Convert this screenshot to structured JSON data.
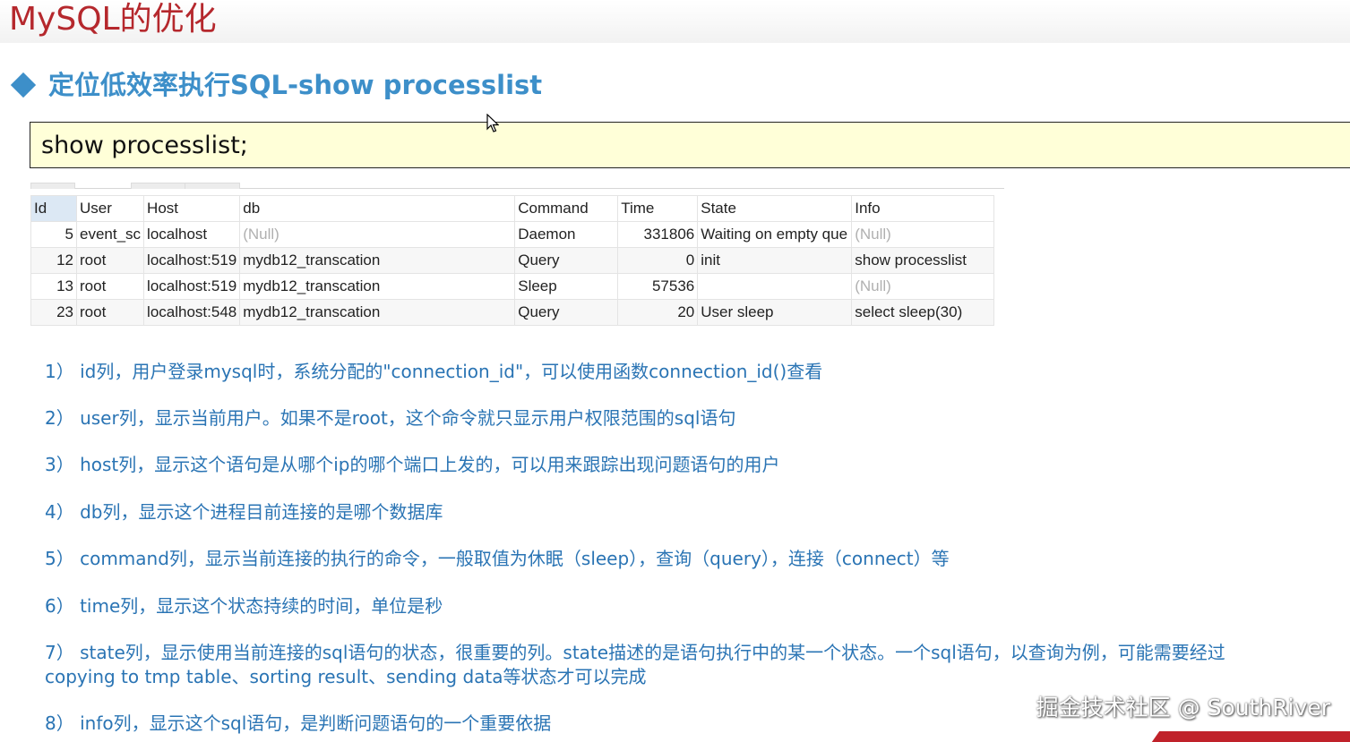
{
  "slide": {
    "title": "MySQL的优化",
    "heading": "定位低效率执行SQL-show processlist",
    "sql": "show processlist;"
  },
  "grid": {
    "columns": [
      "Id",
      "User",
      "Host",
      "db",
      "Command",
      "Time",
      "State",
      "Info"
    ],
    "rows": [
      {
        "id": "5",
        "user": "event_sc",
        "host": "localhost",
        "db": "(Null)",
        "command": "Daemon",
        "time": "331806",
        "state": "Waiting on empty que",
        "info": "(Null)"
      },
      {
        "id": "12",
        "user": "root",
        "host": "localhost:519",
        "db": "mydb12_transcation",
        "command": "Query",
        "time": "0",
        "state": "init",
        "info": "show processlist"
      },
      {
        "id": "13",
        "user": "root",
        "host": "localhost:519",
        "db": "mydb12_transcation",
        "command": "Sleep",
        "time": "57536",
        "state": "",
        "info": "(Null)"
      },
      {
        "id": "23",
        "user": "root",
        "host": "localhost:548",
        "db": "mydb12_transcation",
        "command": "Query",
        "time": "20",
        "state": "User sleep",
        "info": "select sleep(30)"
      }
    ]
  },
  "notes": [
    "1） id列，用户登录mysql时，系统分配的\"connection_id\"，可以使用函数connection_id()查看",
    "2） user列，显示当前用户。如果不是root，这个命令就只显示用户权限范围的sql语句",
    "3） host列，显示这个语句是从哪个ip的哪个端口上发的，可以用来跟踪出现问题语句的用户",
    "4） db列，显示这个进程目前连接的是哪个数据库",
    "5） command列，显示当前连接的执行的命令，一般取值为休眠（sleep），查询（query），连接（connect）等",
    "6） time列，显示这个状态持续的时间，单位是秒",
    "7） state列，显示使用当前连接的sql语句的状态，很重要的列。state描述的是语句执行中的某一个状态。一个sql语句，以查询为例，可能需要经过",
    "copying to tmp table、sorting result、sending data等状态才可以完成",
    "8） info列，显示这个sql语句，是判断问题语句的一个重要依据"
  ],
  "watermark": "掘金技术社区 @ SouthRiver",
  "colors": {
    "title": "#b5282d",
    "heading": "#3d8fc9",
    "notes": "#2a74b4",
    "sql_box": "#ffffd8",
    "null_text": "#b0b0b0",
    "id_header": "#dce8f4"
  },
  "icons": {
    "heading_bullet": "diamond-bullet-icon",
    "pointer": "mouse-pointer-icon"
  }
}
